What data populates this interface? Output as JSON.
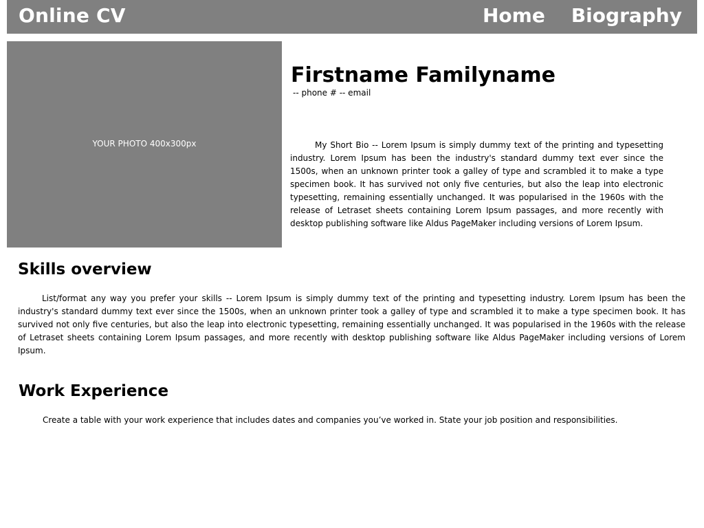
{
  "header": {
    "brand": "Online CV",
    "nav": [
      {
        "label": "Home"
      },
      {
        "label": "Biography"
      }
    ]
  },
  "profile": {
    "photo_label": "YOUR PHOTO 400x300px",
    "name": "Firstname Familyname",
    "contact": "-- phone # -- email",
    "bio": "My Short Bio -- Lorem Ipsum is simply dummy text of the printing and typesetting industry. Lorem Ipsum has been the industry's standard dummy text ever since the 1500s, when an unknown printer took a galley of type and scrambled it to make a type specimen book. It has survived not only five centuries, but also the leap into electronic typesetting, remaining essentially unchanged. It was popularised in the 1960s with the release of Letraset sheets containing Lorem Ipsum passages, and more recently with desktop publishing software like Aldus PageMaker including versions of Lorem Ipsum."
  },
  "skills": {
    "title": "Skills overview",
    "text": "List/format any way you prefer your skills -- Lorem Ipsum is simply dummy text of the printing and typesetting industry. Lorem Ipsum has been the industry's standard dummy text ever since the 1500s, when an unknown printer took a galley of type and scrambled it to make a type specimen book. It has survived not only five centuries, but also the leap into electronic typesetting, remaining essentially unchanged. It was popularised in the 1960s with the release of Letraset sheets containing Lorem Ipsum passages, and more recently with desktop publishing software like Aldus PageMaker including versions of Lorem Ipsum."
  },
  "work": {
    "title": "Work Experience",
    "text": "Create a table with your work experience that includes dates and companies you’ve worked in. State your job position and responsibilities."
  },
  "colors": {
    "bar": "#808080",
    "bar_text": "#ffffff",
    "photo": "#808080",
    "body_text": "#000000",
    "background": "#ffffff"
  }
}
